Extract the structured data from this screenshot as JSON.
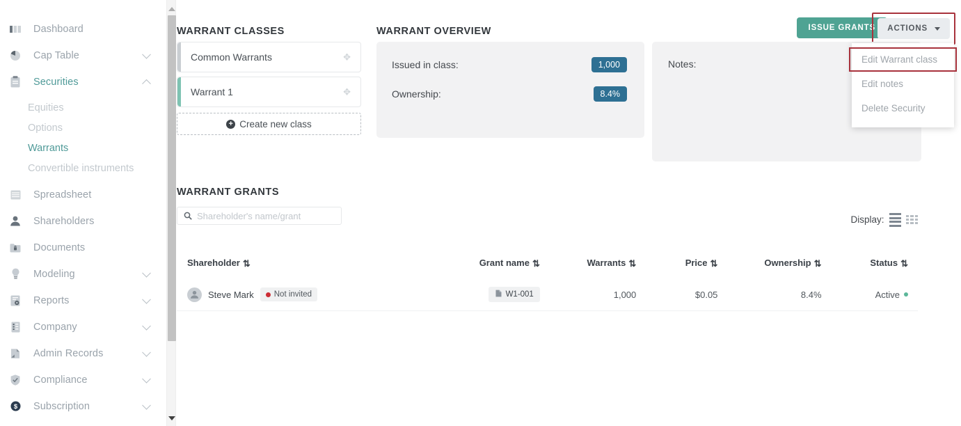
{
  "sidebar": {
    "items": [
      {
        "label": "Dashboard",
        "icon": "bar-chart-icon",
        "expandable": false,
        "active": false
      },
      {
        "label": "Cap Table",
        "icon": "pie-chart-icon",
        "expandable": true,
        "expanded": false,
        "active": false
      },
      {
        "label": "Securities",
        "icon": "clipboard-icon",
        "expandable": true,
        "expanded": true,
        "active": true
      },
      {
        "label": "Spreadsheet",
        "icon": "grid-table-icon",
        "expandable": false,
        "active": false
      },
      {
        "label": "Shareholders",
        "icon": "person-icon",
        "expandable": false,
        "active": false
      },
      {
        "label": "Documents",
        "icon": "folder-lock-icon",
        "expandable": false,
        "active": false
      },
      {
        "label": "Modeling",
        "icon": "lightbulb-icon",
        "expandable": true,
        "expanded": false,
        "active": false
      },
      {
        "label": "Reports",
        "icon": "report-gear-icon",
        "expandable": true,
        "expanded": false,
        "active": false
      },
      {
        "label": "Company",
        "icon": "building-icon",
        "expandable": true,
        "expanded": false,
        "active": false
      },
      {
        "label": "Admin Records",
        "icon": "page-icon",
        "expandable": true,
        "expanded": false,
        "active": false
      },
      {
        "label": "Compliance",
        "icon": "shield-check-icon",
        "expandable": true,
        "expanded": false,
        "active": false
      },
      {
        "label": "Subscription",
        "icon": "dollar-circle-icon",
        "expandable": true,
        "expanded": false,
        "active": false
      }
    ],
    "securities_subitems": [
      {
        "label": "Equities",
        "current": false
      },
      {
        "label": "Options",
        "current": false
      },
      {
        "label": "Warrants",
        "current": true
      },
      {
        "label": "Convertible instruments",
        "current": false
      }
    ]
  },
  "toolbar": {
    "issue_grants_label": "ISSUE GRANTS",
    "actions_label": "ACTIONS",
    "dropdown_items": [
      {
        "label": "Edit Warrant class",
        "highlighted": true
      },
      {
        "label": "Edit notes",
        "highlighted": false
      },
      {
        "label": "Delete Security",
        "highlighted": false
      }
    ]
  },
  "warrant_classes": {
    "title": "WARRANT CLASSES",
    "items": [
      {
        "name": "Common Warrants",
        "selected": false
      },
      {
        "name": "Warrant 1",
        "selected": true
      }
    ],
    "create_label": "Create new class",
    "create_icon": "plus-circle-icon"
  },
  "warrant_overview": {
    "title": "WARRANT OVERVIEW",
    "rows": [
      {
        "label": "Issued in class:",
        "value": "1,000"
      },
      {
        "label": "Ownership:",
        "value": "8.4%"
      }
    ],
    "pill_color": "#2e7093"
  },
  "notes": {
    "label": "Notes:",
    "value": ""
  },
  "warrant_grants": {
    "title": "WARRANT GRANTS",
    "search_placeholder": "Shareholder's name/grant",
    "search_value": "",
    "display_label": "Display:",
    "display_modes": [
      {
        "name": "list-view",
        "selected": true
      },
      {
        "name": "grid-view",
        "selected": false
      }
    ],
    "columns": [
      {
        "label": "Shareholder",
        "align": "left"
      },
      {
        "label": "Grant name",
        "align": "right"
      },
      {
        "label": "Warrants",
        "align": "right"
      },
      {
        "label": "Price",
        "align": "right"
      },
      {
        "label": "Ownership",
        "align": "right"
      },
      {
        "label": "Status",
        "align": "right"
      }
    ],
    "rows": [
      {
        "shareholder": "Steve Mark",
        "invite_status": "Not invited",
        "grant_name": "W1-001",
        "warrants": "1,000",
        "price": "$0.05",
        "ownership": "8.4%",
        "status": "Active"
      }
    ]
  },
  "colors": {
    "accent_teal": "#4fa393",
    "selected_class_bar": "#7ec3b2",
    "pill_blue": "#2e7093",
    "highlight_red": "#a8323c",
    "status_active_dot": "#5cb79a",
    "invite_dot": "#cc2d35"
  }
}
